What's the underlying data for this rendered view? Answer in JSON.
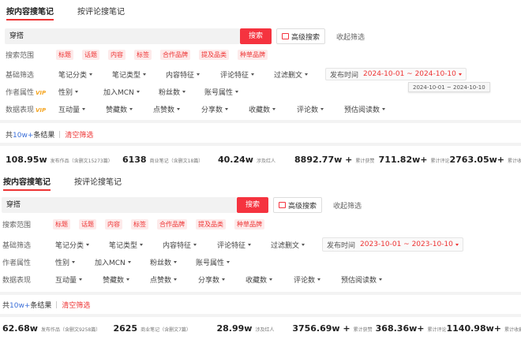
{
  "panels": [
    {
      "tabs": [
        "按内容搜笔记",
        "按评论搜笔记"
      ],
      "search": {
        "value": "穿搭",
        "button": "搜索",
        "advanced": "高级搜索",
        "collapse": "收起筛选"
      },
      "scope": {
        "label": "搜索范围",
        "chips": [
          "标题",
          "话题",
          "内容",
          "标签",
          "合作品牌",
          "提及品类",
          "种草品牌"
        ]
      },
      "basic": {
        "label": "基础筛选",
        "dropdowns": [
          "笔记分类",
          "笔记类型",
          "内容特征",
          "评论特征",
          "过滤删文"
        ],
        "publish_label": "发布时间",
        "date_range": "2024-10-01 ~ 2024-10-10"
      },
      "tooltip": "2024-10-01 ~ 2024-10-10",
      "author": {
        "label": "作者属性",
        "vip": "VIP",
        "dropdowns": [
          "性别",
          "加入MCN",
          "粉丝数",
          "账号属性"
        ]
      },
      "data": {
        "label": "数据表现",
        "vip": "VIP",
        "dropdowns": [
          "互动量",
          "赞藏数",
          "点赞数",
          "分享数",
          "收藏数",
          "评论数",
          "预估阅读数"
        ]
      },
      "result": {
        "prefix": "共",
        "count": "10w+",
        "suffix": "条结果",
        "clear": "清空筛选"
      },
      "stats": [
        {
          "value": "108.95w",
          "label": "发布作品（含删文15273篇）"
        },
        {
          "value": "6138",
          "label": "商业笔记（含删文18篇）"
        },
        {
          "value": "40.24w",
          "label": "涉及红人"
        },
        {
          "value": "8892.77w +",
          "label": "累计获赞"
        },
        {
          "value": "711.82w+",
          "label": "累计评论"
        },
        {
          "value": "2763.05w+",
          "label": "累计收藏"
        }
      ]
    },
    {
      "tabs": [
        "按内容搜笔记",
        "按评论搜笔记"
      ],
      "search": {
        "value": "穿搭",
        "button": "搜索",
        "advanced": "高级搜索",
        "collapse": "收起筛选"
      },
      "scope": {
        "label": "搜索范围",
        "chips": [
          "标题",
          "话题",
          "内容",
          "标签",
          "合作品牌",
          "提及品类",
          "种草品牌"
        ]
      },
      "basic": {
        "label": "基础筛选",
        "dropdowns": [
          "笔记分类",
          "笔记类型",
          "内容特征",
          "评论特征",
          "过滤删文"
        ],
        "publish_label": "发布时间",
        "date_range": "2023-10-01 ~ 2023-10-10"
      },
      "author": {
        "label": "作者属性",
        "vip": "",
        "dropdowns": [
          "性别",
          "加入MCN",
          "粉丝数",
          "账号属性"
        ]
      },
      "data": {
        "label": "数据表现",
        "vip": "",
        "dropdowns": [
          "互动量",
          "赞藏数",
          "点赞数",
          "分享数",
          "收藏数",
          "评论数",
          "预估阅读数"
        ]
      },
      "result": {
        "prefix": "共",
        "count": "10w+",
        "suffix": "条结果",
        "clear": "清空筛选"
      },
      "stats": [
        {
          "value": "62.68w",
          "label": "发布作品（含删文9258篇）"
        },
        {
          "value": "2625",
          "label": "商业笔记（含删文7篇）"
        },
        {
          "value": "28.99w",
          "label": "涉及红人"
        },
        {
          "value": "3756.69w +",
          "label": "累计获赞"
        },
        {
          "value": "368.36w+",
          "label": "累计评论"
        },
        {
          "value": "1140.98w+",
          "label": "累计收藏"
        }
      ]
    }
  ],
  "colors": {
    "accent": "#f5333f",
    "count": "#3b6fd8",
    "vip": "#f5a623"
  }
}
